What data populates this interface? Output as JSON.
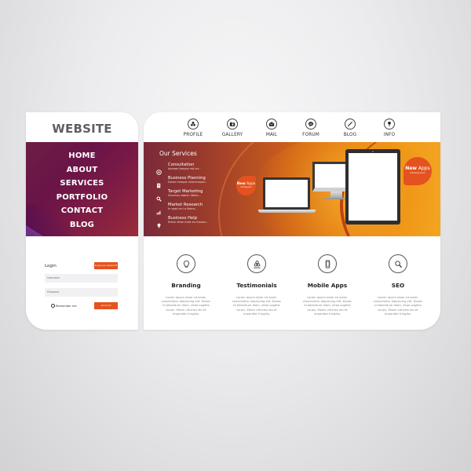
{
  "sidebar": {
    "brand": "WEBSITE",
    "menu": [
      "HOME",
      "ABOUT",
      "SERVICES",
      "PORTFOLIO",
      "CONTACT",
      "BLOG"
    ],
    "login": {
      "title": "Login",
      "forgot_label": "Forgot your password?",
      "username_placeholder": "Username",
      "password_placeholder": "Password",
      "remember_label": "Remember me",
      "submit_label": "Join Us Or"
    }
  },
  "topnav": {
    "items": [
      {
        "label": "PROFILE",
        "icon": "users-icon"
      },
      {
        "label": "GALLERY",
        "icon": "camera-icon"
      },
      {
        "label": "MAIL",
        "icon": "mail-icon"
      },
      {
        "label": "FORUM",
        "icon": "chat-icon"
      },
      {
        "label": "BLOG",
        "icon": "pen-icon"
      },
      {
        "label": "INFO",
        "icon": "pin-icon"
      }
    ]
  },
  "hero": {
    "services_title": "Our Services",
    "services": [
      {
        "name": "Consultation",
        "desc": "Aenean tempor est eu...",
        "icon": "chat-icon"
      },
      {
        "name": "Business Planning",
        "desc": "Donec tempor ullamcorper...",
        "icon": "document-icon"
      },
      {
        "name": "Target Marketing",
        "desc": "Vivamus sapien libero...",
        "icon": "search-icon"
      },
      {
        "name": "Market Research",
        "desc": "In eget orci a libero...",
        "icon": "bar-chart-icon"
      },
      {
        "name": "Business Help",
        "desc": "Etiam vitae nulla eu mauris...",
        "icon": "lightbulb-icon"
      }
    ],
    "badge_small": {
      "new": "New",
      "apps": " Apps",
      "sub": "Coming soon"
    },
    "badge_big": {
      "new": "New",
      "apps": " Apps",
      "sub": "Coming soon"
    }
  },
  "features": [
    {
      "title": "Branding",
      "icon": "lightbulb-icon",
      "text": "Lorem ipsum dolor sit amet, consectetur adipiscing elit. Donec id bibendum diam, vitae sagittis turpis. Etiam ultricies leo et imperdiet fringilla."
    },
    {
      "title": "Testimonials",
      "icon": "users-icon",
      "text": "Lorem ipsum dolor sit amet, consectetur adipiscing elit. Donec id bibendum diam, vitae sagittis turpis. Etiam ultricies leo et imperdiet fringilla."
    },
    {
      "title": "Mobile Apps",
      "icon": "smartphone-icon",
      "text": "Lorem ipsum dolor sit amet, consectetur adipiscing elit. Donec id bibendum diam, vitae sagittis turpis. Etiam ultricies leo et imperdiet fringilla."
    },
    {
      "title": "SEO",
      "icon": "search-icon",
      "text": "Lorem ipsum dolor sit amet, consectetur adipiscing elit. Donec id bibendum diam, vitae sagittis turpis. Etiam ultricies leo et imperdiet fringilla."
    }
  ],
  "colors": {
    "accent": "#e4531f",
    "menu_bg": "#6d1d45",
    "hero_orange": "#f09a18"
  }
}
